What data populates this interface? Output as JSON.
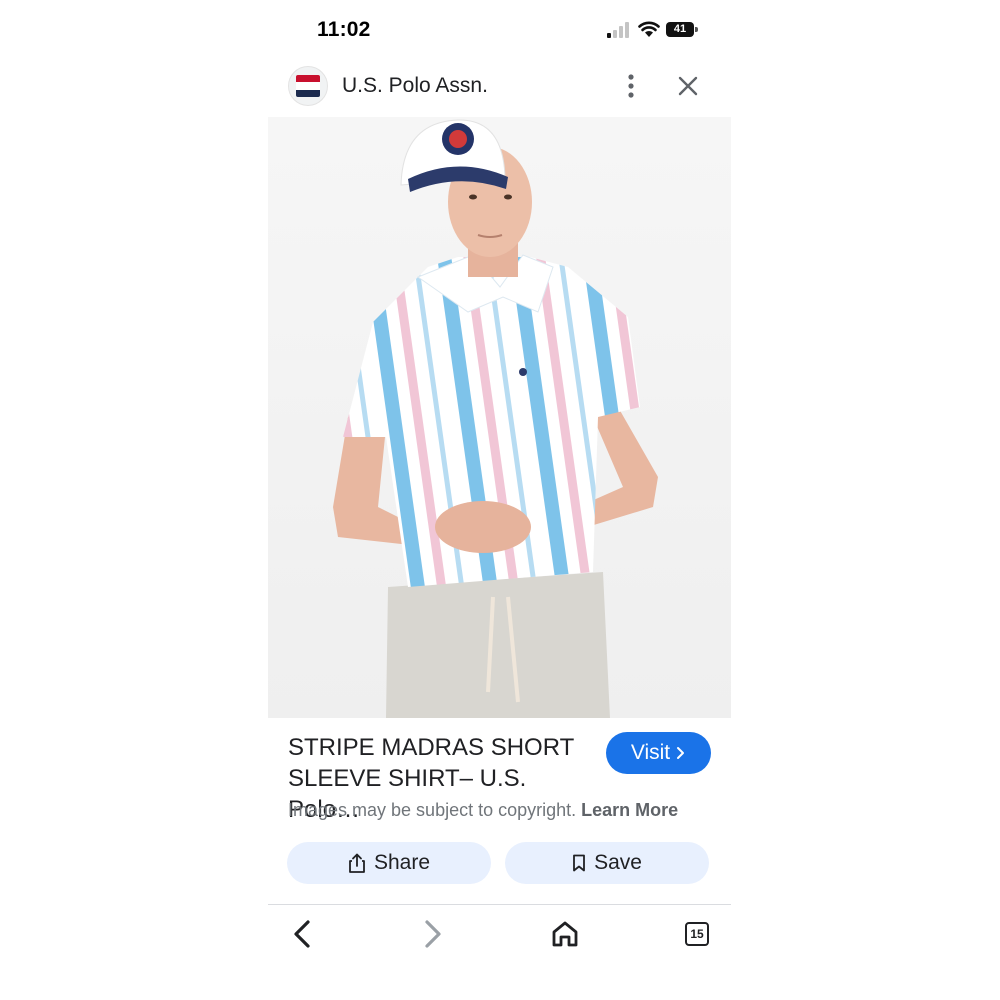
{
  "status_bar": {
    "time": "11:02",
    "battery": "41"
  },
  "header": {
    "site_name": "U.S. Polo Assn.",
    "menu_icon": "more-vert-icon",
    "close_icon": "close-icon"
  },
  "image": {
    "subject": "product-photo"
  },
  "result": {
    "title_line1": "STRIPE MADRAS SHORT",
    "title_line2": "SLEEVE SHIRT– U.S. Polo…",
    "visit_label": "Visit",
    "copyright_text": "Images may be subject to copyright.",
    "learn_more": "Learn More"
  },
  "actions": {
    "share_label": "Share",
    "save_label": "Save"
  },
  "bottom_nav": {
    "tabs_count": "15"
  },
  "colors": {
    "accent": "#1a73e8",
    "pill_bg": "#e8f0fe",
    "flag_red": "#c8102e",
    "flag_navy": "#1b2a4e"
  }
}
